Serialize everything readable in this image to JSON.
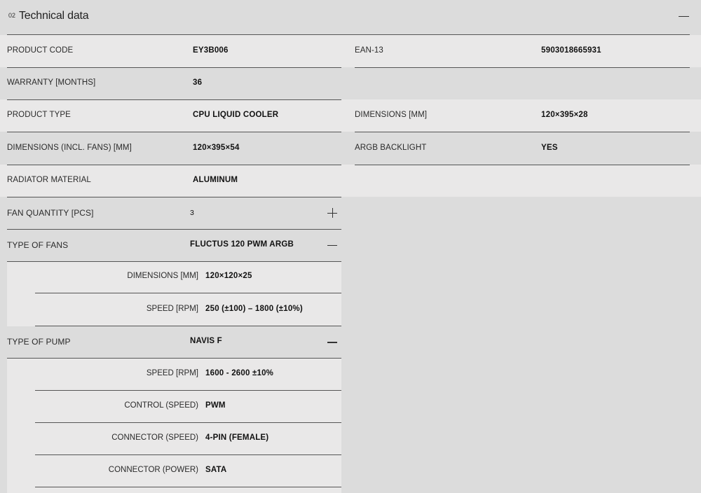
{
  "section": {
    "number": "02",
    "title": "Technical data"
  },
  "rows_left": [
    {
      "label": "PRODUCT CODE",
      "value": "EY3B006"
    },
    {
      "label": "WARRANTY [MONTHS]",
      "value": "36"
    },
    {
      "label": "PRODUCT TYPE",
      "value": "CPU LIQUID COOLER"
    },
    {
      "label": "DIMENSIONS (INCL. FANS) [MM]",
      "value": "120×395×54"
    },
    {
      "label": "RADIATOR MATERIAL",
      "value": "ALUMINUM"
    }
  ],
  "rows_right": [
    {
      "label": "EAN-13",
      "value": "5903018665931"
    },
    {
      "label": "DIMENSIONS [MM]",
      "value": "120×395×28"
    },
    {
      "label": "ARGB BACKLIGHT",
      "value": "YES"
    }
  ],
  "fan_quantity": {
    "label": "FAN QUANTITY [PCS]",
    "value": "3"
  },
  "fans": {
    "label": "TYPE OF FANS",
    "value": "FLUCTUS 120 PWM ARGB",
    "details": [
      {
        "label": "DIMENSIONS [MM]",
        "value": "120×120×25"
      },
      {
        "label": "SPEED [RPM]",
        "value": "250 (±100) – 1800 (±10%)"
      }
    ]
  },
  "pump": {
    "label": "TYPE OF PUMP",
    "value": "NAVIS F",
    "details": [
      {
        "label": "SPEED [RPM]",
        "value": "1600 - 2600 ±10%"
      },
      {
        "label": "CONTROL (SPEED)",
        "value": "PWM"
      },
      {
        "label": "CONNECTOR (SPEED)",
        "value": "4-PIN (FEMALE)"
      },
      {
        "label": "CONNECTOR (POWER)",
        "value": "SATA"
      }
    ]
  }
}
